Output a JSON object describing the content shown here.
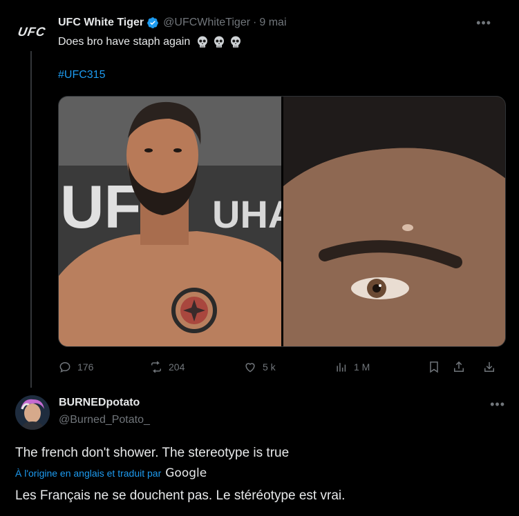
{
  "tweet": {
    "author_name": "UFC White Tiger",
    "author_handle": "@UFCWhiteTiger",
    "date": "9 mai",
    "avatar_text": "UFC",
    "text": "Does bro have staph again",
    "emoji": "skull",
    "hashtag": "#UFC315",
    "media": {
      "left_backdrop_text": "UFC",
      "left_backdrop_text2": "UHA"
    },
    "stats": {
      "replies": "176",
      "reposts": "204",
      "likes": "5 k",
      "views": "1 M"
    }
  },
  "reply": {
    "author_name": "BURNEDpotato",
    "author_handle": "@Burned_Potato_",
    "text": "The french don't shower. The stereotype is true",
    "translated_label": "À l'origine en anglais et traduit par",
    "translator": "Google",
    "translation": "Les Français ne se douchent pas. Le stéréotype est vrai."
  },
  "colors": {
    "background": "#000000",
    "text": "#e7e9ea",
    "muted": "#71767b",
    "link": "#1d9bf0",
    "verified": "#1d9bf0"
  }
}
